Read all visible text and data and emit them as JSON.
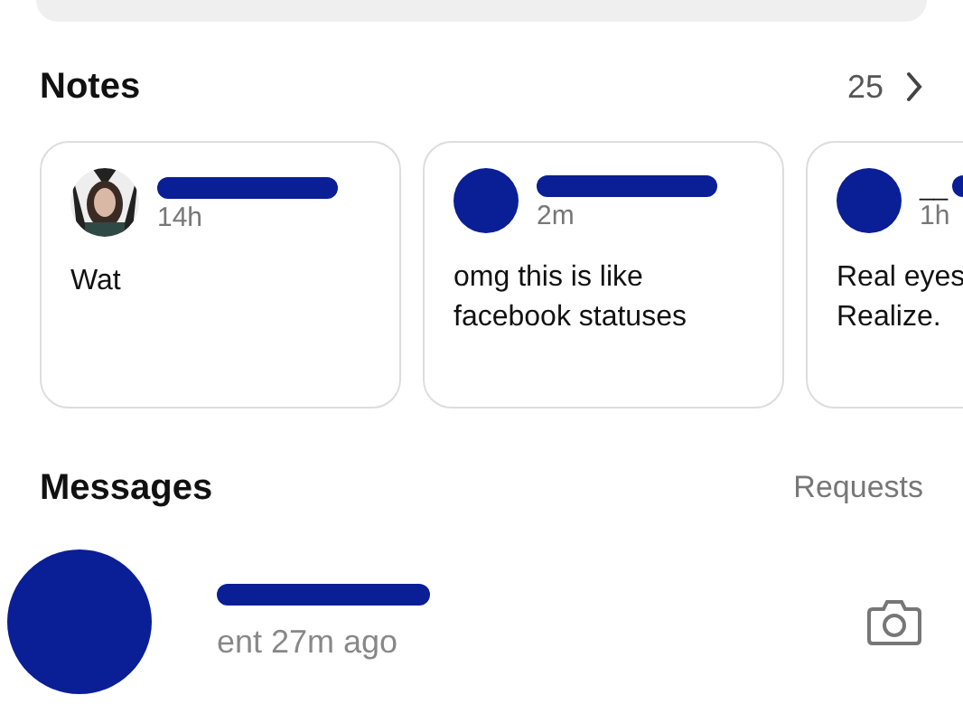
{
  "notes": {
    "title": "Notes",
    "count": "25"
  },
  "note_cards": [
    {
      "time": "14h",
      "text": "Wat"
    },
    {
      "kind": "redacted",
      "time": "2m",
      "text": "omg this is like facebook statuses"
    },
    {
      "kind": "redacted",
      "time": "1h",
      "text": "Real eyes\nRealize.",
      "username": "__"
    }
  ],
  "messages": {
    "title": "Messages",
    "requests": "Requests"
  },
  "message_rows": [
    {
      "status": "ent 27m ago"
    }
  ]
}
